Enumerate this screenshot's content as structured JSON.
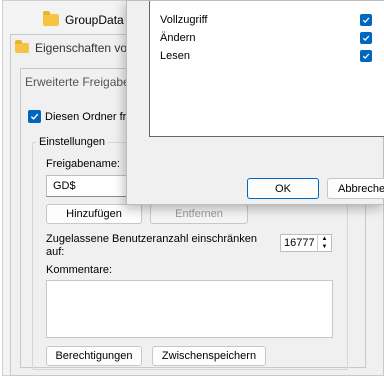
{
  "explorer": {
    "tab_title": "GroupData"
  },
  "properties": {
    "title": "Eigenschaften vo"
  },
  "advanced": {
    "title": "Erweiterte Freigabe",
    "share_checkbox_label": "Diesen Ordner fre",
    "share_checked": true,
    "settings_legend": "Einstellungen",
    "share_name_label": "Freigabename:",
    "share_name_value": "GD$",
    "add_button": "Hinzufügen",
    "remove_button": "Entfernen",
    "limit_label_line1": "Zugelassene Benutzeranzahl einschränken",
    "limit_label_line2": "auf:",
    "limit_value": "16777",
    "comments_label": "Kommentare:",
    "permissions_button": "Berechtigungen",
    "cache_button": "Zwischenspeichern"
  },
  "permissions": {
    "rows": [
      {
        "label": "Vollzugriff",
        "allowed": true
      },
      {
        "label": "Ändern",
        "allowed": true
      },
      {
        "label": "Lesen",
        "allowed": true
      }
    ],
    "ok_button": "OK",
    "cancel_button": "Abbrechen"
  },
  "colors": {
    "accent": "#0067c0",
    "folder": "#f5c443"
  }
}
